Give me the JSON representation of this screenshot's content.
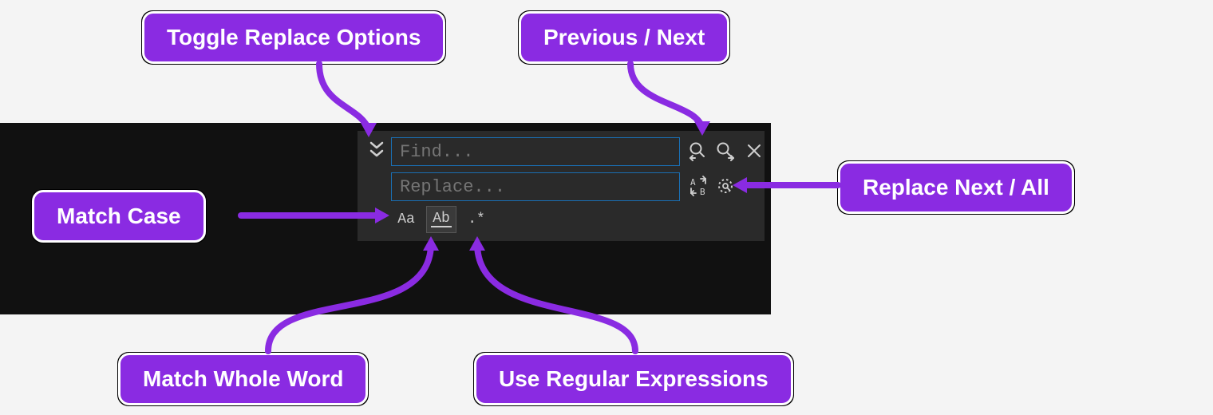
{
  "callouts": {
    "toggle_replace": "Toggle Replace Options",
    "prev_next": "Previous / Next",
    "match_case": "Match Case",
    "replace_next_all": "Replace Next / All",
    "match_whole_word": "Match Whole Word",
    "use_regex": "Use Regular Expressions"
  },
  "find_widget": {
    "find_placeholder": "Find...",
    "replace_placeholder": "Replace...",
    "options": {
      "match_case_label": "Aa",
      "match_word_label": "Ab",
      "regex_label": ".*"
    }
  }
}
